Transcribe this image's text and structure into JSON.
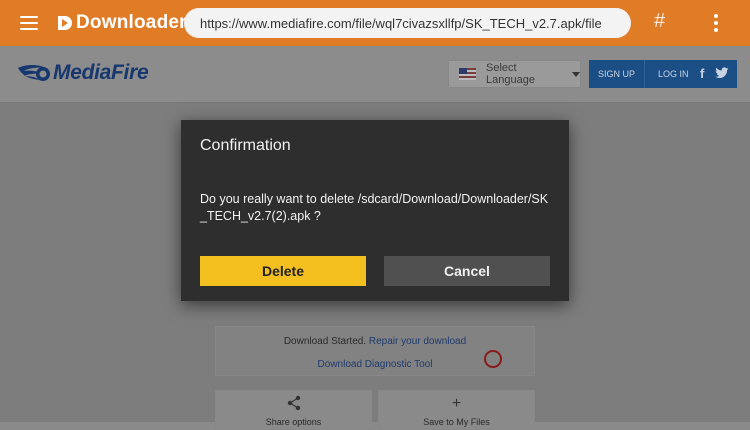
{
  "appbar": {
    "app_name": "Downloader",
    "url": "https://www.mediafire.com/file/wql7civazsxllfp/SK_TECH_v2.7.apk/file",
    "hash_symbol": "#",
    "accent_color": "#e07b26"
  },
  "site": {
    "logo_text": "MediaFire",
    "language_label": "Select Language",
    "signup_label": "SIGN UP",
    "login_label": "LOG IN",
    "facebook_glyph": "f",
    "download_started": "Download Started.",
    "repair_link": "Repair your download",
    "diagnostic_link": "Download Diagnostic Tool",
    "share_label": "Share options",
    "save_label": "Save to My Files",
    "save_glyph": "+"
  },
  "dialog": {
    "title": "Confirmation",
    "message": "Do you really want to delete /sdcard/Download/Downloader/SK_TECH_v2.7(2).apk ?",
    "delete_label": "Delete",
    "cancel_label": "Cancel",
    "delete_color": "#f3c020"
  }
}
